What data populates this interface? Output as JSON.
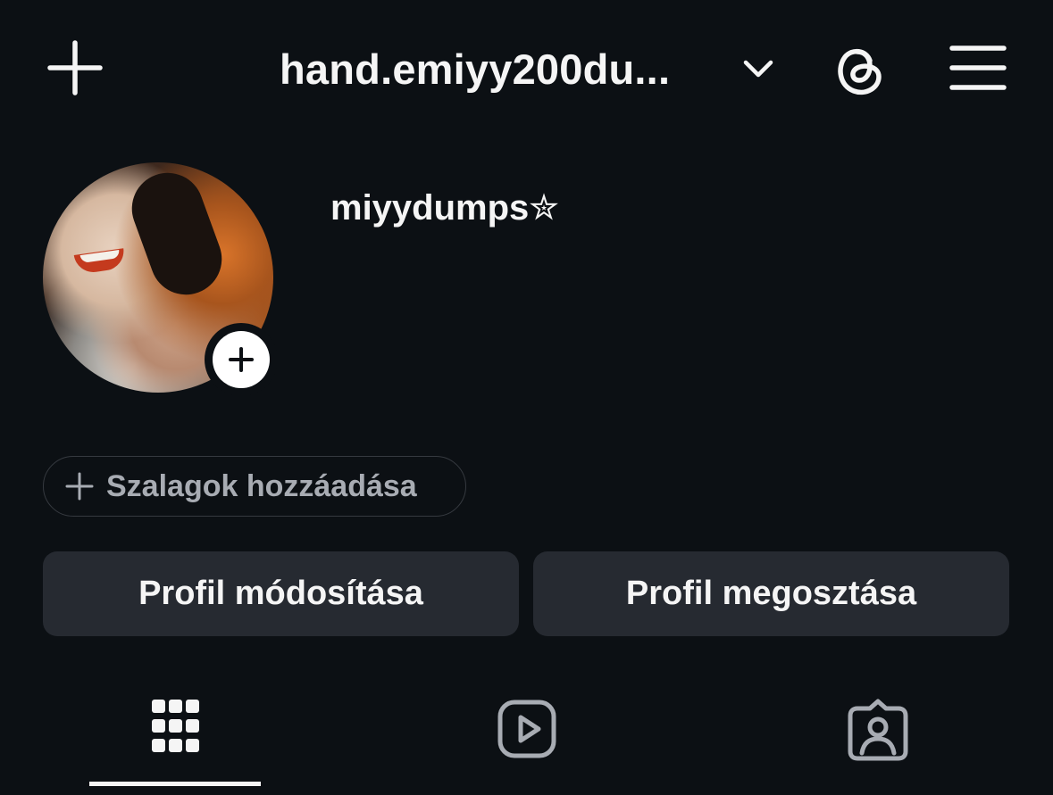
{
  "header": {
    "username": "hand.emiyy200du...",
    "icons": {
      "create": "plus-icon",
      "account_switch": "chevron-down-icon",
      "threads": "threads-icon",
      "menu": "hamburger-menu-icon"
    }
  },
  "profile": {
    "display_name": "miyydumps✮",
    "avatar": "profile-photo",
    "story_add_icon": "plus-icon"
  },
  "ribbon_chip": {
    "label": "Szalagok hozzáadása",
    "icon": "plus-icon"
  },
  "actions": {
    "edit_label": "Profil módosítása",
    "share_label": "Profil megosztása"
  },
  "tabs": [
    {
      "name": "posts",
      "icon": "grid-icon",
      "active": true
    },
    {
      "name": "reels",
      "icon": "reels-icon",
      "active": false
    },
    {
      "name": "tagged",
      "icon": "tagged-person-icon",
      "active": false
    }
  ],
  "colors": {
    "background": "#0c1014",
    "button": "#262a31",
    "text_primary": "#f5f5f5",
    "text_secondary": "#a8acb3",
    "inactive_icon": "#a8acb3"
  }
}
